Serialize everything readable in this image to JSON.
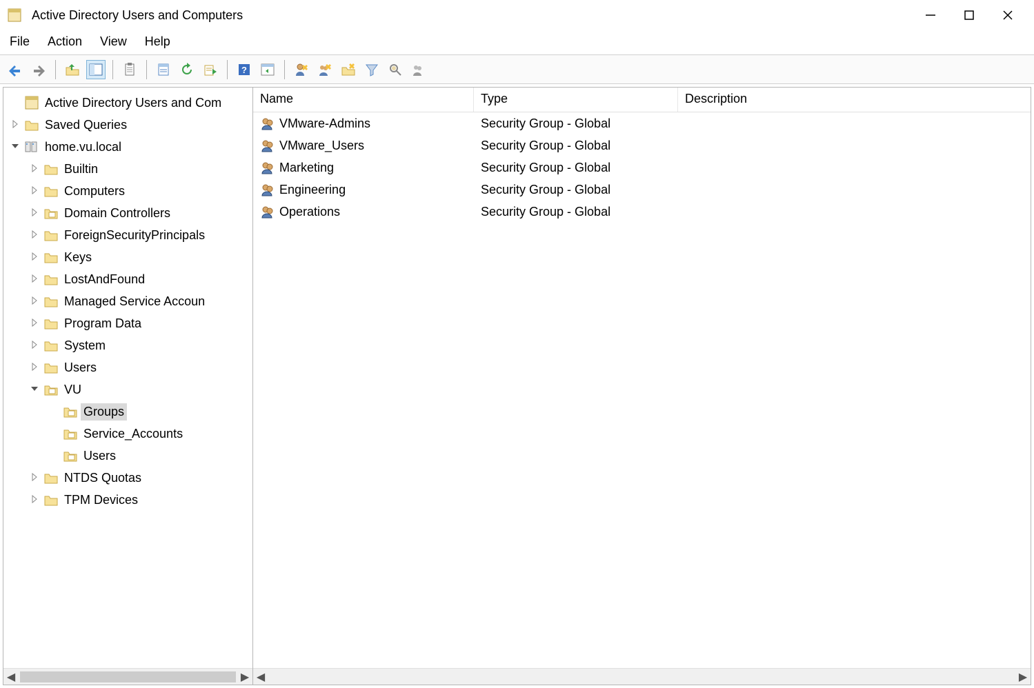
{
  "window": {
    "title": "Active Directory Users and Computers"
  },
  "menu": {
    "items": [
      "File",
      "Action",
      "View",
      "Help"
    ]
  },
  "toolbar": {
    "icons": [
      "back-arrow",
      "forward-arrow",
      "|",
      "up-folder",
      "show-hide-console-tree",
      "|",
      "clipboard",
      "|",
      "properties",
      "refresh",
      "export-list",
      "|",
      "help",
      "show-hide-action-pane",
      "|",
      "new-user",
      "new-group",
      "new-ou",
      "filter",
      "find",
      "add-to-group"
    ]
  },
  "tree": {
    "root_label": "Active Directory Users and Com",
    "nodes": [
      {
        "indent": 0,
        "expand": "none",
        "icon": "app",
        "label": "Active Directory Users and Com"
      },
      {
        "indent": 0,
        "expand": "closed",
        "icon": "folder",
        "label": "Saved Queries"
      },
      {
        "indent": 0,
        "expand": "open",
        "icon": "domain",
        "label": "home.vu.local"
      },
      {
        "indent": 1,
        "expand": "closed",
        "icon": "folder",
        "label": "Builtin"
      },
      {
        "indent": 1,
        "expand": "closed",
        "icon": "folder",
        "label": "Computers"
      },
      {
        "indent": 1,
        "expand": "closed",
        "icon": "ou",
        "label": "Domain Controllers"
      },
      {
        "indent": 1,
        "expand": "closed",
        "icon": "folder",
        "label": "ForeignSecurityPrincipals"
      },
      {
        "indent": 1,
        "expand": "closed",
        "icon": "folder",
        "label": "Keys"
      },
      {
        "indent": 1,
        "expand": "closed",
        "icon": "folder",
        "label": "LostAndFound"
      },
      {
        "indent": 1,
        "expand": "closed",
        "icon": "folder",
        "label": "Managed Service Accoun"
      },
      {
        "indent": 1,
        "expand": "closed",
        "icon": "folder",
        "label": "Program Data"
      },
      {
        "indent": 1,
        "expand": "closed",
        "icon": "folder",
        "label": "System"
      },
      {
        "indent": 1,
        "expand": "closed",
        "icon": "folder",
        "label": "Users"
      },
      {
        "indent": 1,
        "expand": "open",
        "icon": "ou",
        "label": "VU"
      },
      {
        "indent": 2,
        "expand": "none",
        "icon": "ou",
        "label": "Groups",
        "selected": true
      },
      {
        "indent": 2,
        "expand": "none",
        "icon": "ou",
        "label": "Service_Accounts"
      },
      {
        "indent": 2,
        "expand": "none",
        "icon": "ou",
        "label": "Users"
      },
      {
        "indent": 1,
        "expand": "closed",
        "icon": "folder",
        "label": "NTDS Quotas"
      },
      {
        "indent": 1,
        "expand": "closed",
        "icon": "folder",
        "label": "TPM Devices"
      }
    ]
  },
  "list": {
    "columns": {
      "name": "Name",
      "type": "Type",
      "description": "Description"
    },
    "rows": [
      {
        "name": "VMware-Admins",
        "type": "Security Group - Global",
        "description": ""
      },
      {
        "name": "VMware_Users",
        "type": "Security Group - Global",
        "description": ""
      },
      {
        "name": "Marketing",
        "type": "Security Group - Global",
        "description": ""
      },
      {
        "name": "Engineering",
        "type": "Security Group - Global",
        "description": ""
      },
      {
        "name": "Operations",
        "type": "Security Group - Global",
        "description": ""
      }
    ]
  }
}
